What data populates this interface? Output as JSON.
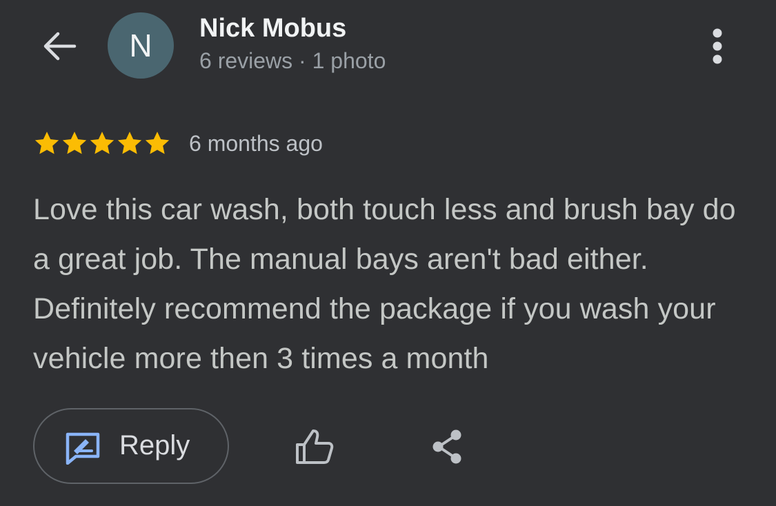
{
  "header": {
    "back_icon": "arrow-back-icon",
    "avatar_letter": "N",
    "author_name": "Nick Mobus",
    "author_meta": "6 reviews · 1 photo",
    "more_icon": "more-vert-icon"
  },
  "review": {
    "rating": 5,
    "rating_max": 5,
    "time": "6 months ago",
    "text": "Love this car wash, both touch less and brush bay do a great job. The manual bays aren't bad either. Definitely recommend the package if you wash your vehicle more then 3 times a month"
  },
  "actions": {
    "reply_label": "Reply",
    "reply_icon": "reply-edit-icon",
    "like_icon": "thumb-up-icon",
    "share_icon": "share-icon"
  },
  "colors": {
    "background": "#2f3033",
    "star": "#fbbc04",
    "reply_icon": "#8ab4f8",
    "avatar": "#4a6670"
  }
}
